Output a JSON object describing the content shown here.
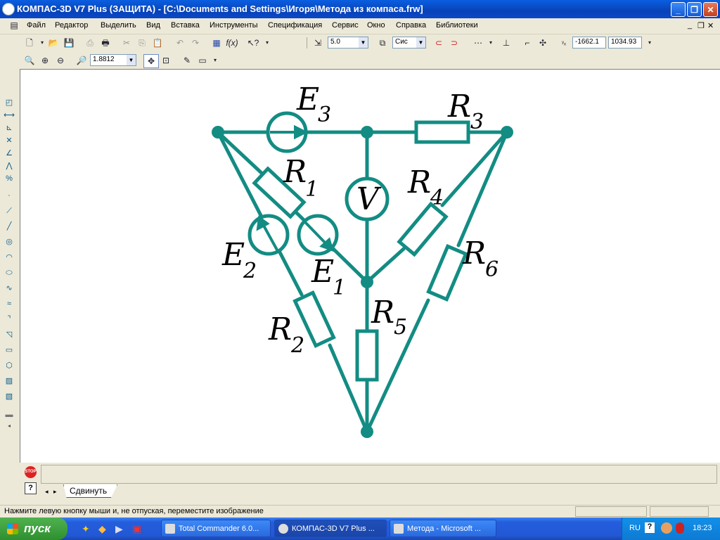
{
  "window": {
    "title": "КОМПАС-3D V7 Plus (ЗАЩИТА) - [C:\\Documents and Settings\\Игоря\\Метода из компаса.frw]",
    "minimize": "_",
    "maximize": "❐",
    "close": "✕"
  },
  "menu": {
    "items": [
      "Файл",
      "Редактор",
      "Выделить",
      "Вид",
      "Вставка",
      "Инструменты",
      "Спецификация",
      "Сервис",
      "Окно",
      "Справка",
      "Библиотеки"
    ]
  },
  "toolbar": {
    "step_value": "5.0",
    "system_value": "Сис",
    "coord_x": "-1662.1",
    "coord_y": "1034.93",
    "zoom_value": "1.8812"
  },
  "schematic": {
    "color": "#138c83",
    "labels": {
      "E3": "E",
      "E3_sub": "3",
      "R3": "R",
      "R3_sub": "3",
      "R1": "R",
      "R1_sub": "1",
      "V": "V",
      "R4": "R",
      "R4_sub": "4",
      "E2": "E",
      "E2_sub": "2",
      "E1": "E",
      "E1_sub": "1",
      "R6": "R",
      "R6_sub": "6",
      "R5": "R",
      "R5_sub": "5",
      "R2": "R",
      "R2_sub": "2"
    }
  },
  "bottom": {
    "tab_label": "Сдвинуть",
    "stop_label": "STOP",
    "help_label": "?"
  },
  "status": {
    "message": "Нажмите левую кнопку мыши и, не отпуская, переместите изображение"
  },
  "taskbar": {
    "start_label": "пуск",
    "tasks": [
      "Total Commander 6.0...",
      "КОМПАС-3D V7 Plus ...",
      "Метода - Microsoft ..."
    ],
    "language": "RU",
    "clock": "18:23"
  }
}
